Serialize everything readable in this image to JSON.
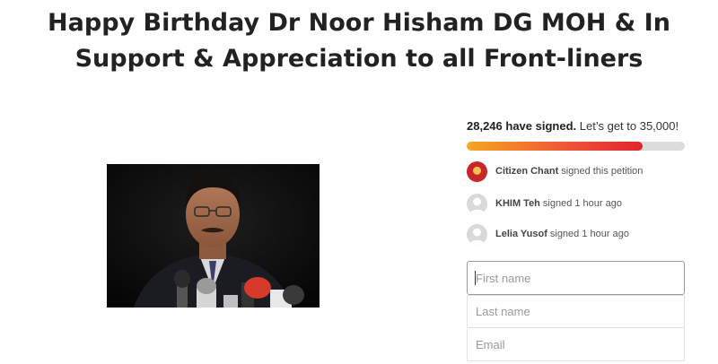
{
  "petition": {
    "title_line1": "Happy Birthday Dr Noor Hisham DG MOH & In",
    "title_line2": "Support & Appreciation to all Front-liners"
  },
  "signatures": {
    "count_text": "28,246 have signed.",
    "goal_text": "Let’s get to 35,000!",
    "progress_fraction": 0.807,
    "progress_colors": [
      "#f5a623",
      "#ef5136",
      "#e0252c"
    ]
  },
  "recent_signers": [
    {
      "name": "Citizen Chant",
      "action": "signed this petition",
      "avatar": "red-logo"
    },
    {
      "name": "KHIM Teh",
      "action": "signed 1 hour ago",
      "avatar": "default-user-icon"
    },
    {
      "name": "Lelia Yusof",
      "action": "signed 1 hour ago",
      "avatar": "default-user-icon"
    }
  ],
  "form": {
    "first_name_placeholder": "First name",
    "last_name_placeholder": "Last name",
    "email_placeholder": "Email"
  }
}
